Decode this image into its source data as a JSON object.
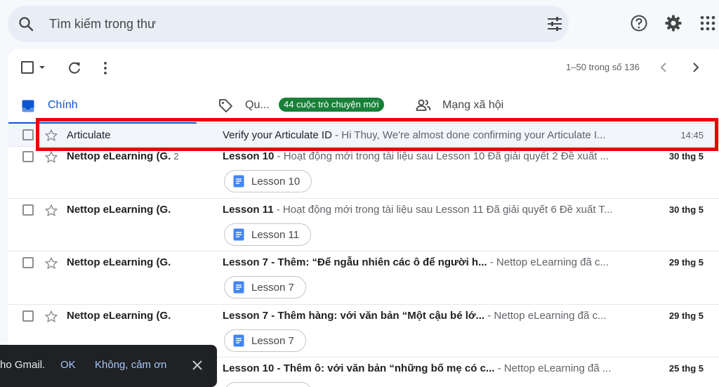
{
  "search": {
    "placeholder": "Tìm kiếm trong thư"
  },
  "icons": {
    "search": "search-icon",
    "filter": "tune-icon",
    "help": "help-icon",
    "settings": "gear-icon",
    "apps": "apps-grid-icon"
  },
  "toolbar": {
    "pager_text": "1–50 trong số 136"
  },
  "tabs": [
    {
      "label": "Chính",
      "active": true
    },
    {
      "label": "Qu...",
      "badge": "44 cuộc trò chuyện mới"
    },
    {
      "label": "Mạng xã hội"
    }
  ],
  "colors": {
    "accent": "#0b57d0",
    "badge": "#188038",
    "highlight": "#ea0000"
  },
  "emails": [
    {
      "sender": "Articulate",
      "count": "",
      "subject": "Verify your Articulate ID",
      "snippet": " - Hi Thuy, We're almost done confirming your Articulate I...",
      "date": "14:45",
      "unread": false,
      "attachment": ""
    },
    {
      "sender": "Nettop eLearning (G.",
      "count": "2",
      "subject": "Lesson 10",
      "snippet": " - Hoạt động mới trong tài liệu sau Lesson 10 Đã giải quyết 2 Đề xuất ...",
      "date": "30 thg 5",
      "unread": true,
      "attachment": "Lesson 10"
    },
    {
      "sender": "Nettop eLearning (G.",
      "count": "",
      "subject": "Lesson 11",
      "snippet": " - Hoạt động mới trong tài liệu sau Lesson 11 Đã giải quyết 6 Đề xuất T...",
      "date": "30 thg 5",
      "unread": true,
      "attachment": "Lesson 11"
    },
    {
      "sender": "Nettop eLearning (G.",
      "count": "",
      "subject": "Lesson 7 - Thêm: “Để ngẫu nhiên các ô để người h...",
      "snippet": " - Nettop eLearning đã c...",
      "date": "29 thg 5",
      "unread": true,
      "attachment": "Lesson 7"
    },
    {
      "sender": "Nettop eLearning (G.",
      "count": "",
      "subject": "Lesson 7 - Thêm hàng: với văn bản “Một cậu bé lớ...",
      "snippet": " - Nettop eLearning đã c...",
      "date": "29 thg 5",
      "unread": true,
      "attachment": "Lesson 7"
    },
    {
      "sender": "",
      "count": "",
      "subject": "Lesson 10 - Thêm ô: với văn bản “những bố mẹ có c...",
      "snippet": " - Nettop eLearning đã ...",
      "date": "25 thg 5",
      "unread": true,
      "attachment": ""
    }
  ],
  "snackbar": {
    "text": "ho Gmail.",
    "ok": "OK",
    "dismiss": "Không, cảm ơn"
  }
}
